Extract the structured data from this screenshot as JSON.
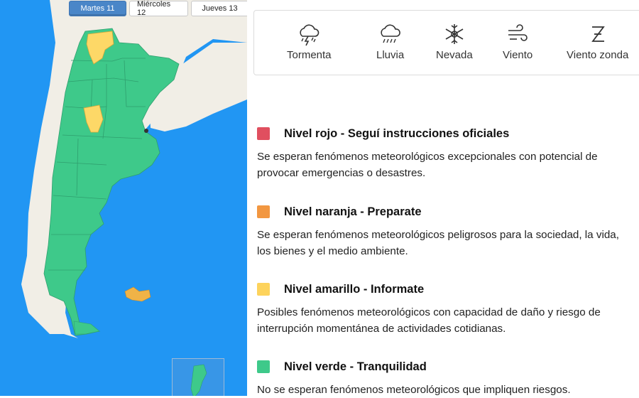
{
  "days": [
    {
      "label": "Martes 11",
      "active": true
    },
    {
      "label": "Miércoles 12",
      "active": false
    },
    {
      "label": "Jueves 13",
      "active": false
    }
  ],
  "map": {
    "colors": {
      "sea": "#2196f3",
      "neighbor_land": "#f1eee6",
      "green": "#3ec98a",
      "yellow": "#fdd867",
      "islands": "#f0b347"
    },
    "yellow_alert_areas": 2
  },
  "phenomena": [
    {
      "icon": "storm-icon",
      "label": "Tormenta"
    },
    {
      "icon": "rain-icon",
      "label": "Lluvia"
    },
    {
      "icon": "snow-icon",
      "label": "Nevada"
    },
    {
      "icon": "wind-icon",
      "label": "Viento"
    },
    {
      "icon": "zonda-wind-icon",
      "label": "Viento zonda"
    }
  ],
  "levels": [
    {
      "color": "#e04f5f",
      "title": "Nivel rojo - Seguí instrucciones oficiales",
      "description": "Se esperan fenómenos meteorológicos excepcionales con potencial de provocar emergencias o desastres."
    },
    {
      "color": "#f29741",
      "title": "Nivel naranja - Preparate",
      "description": "Se esperan fenómenos meteorológicos peligrosos para la sociedad, la vida, los bienes y el medio ambiente."
    },
    {
      "color": "#fdd35c",
      "title": "Nivel amarillo - Informate",
      "description": "Posibles fenómenos meteorológicos con capacidad de daño y riesgo de interrupción momentánea de actividades cotidianas."
    },
    {
      "color": "#3ec98a",
      "title": "Nivel verde - Tranquilidad",
      "description": "No se esperan fenómenos meteorológicos que impliquen riesgos."
    }
  ]
}
